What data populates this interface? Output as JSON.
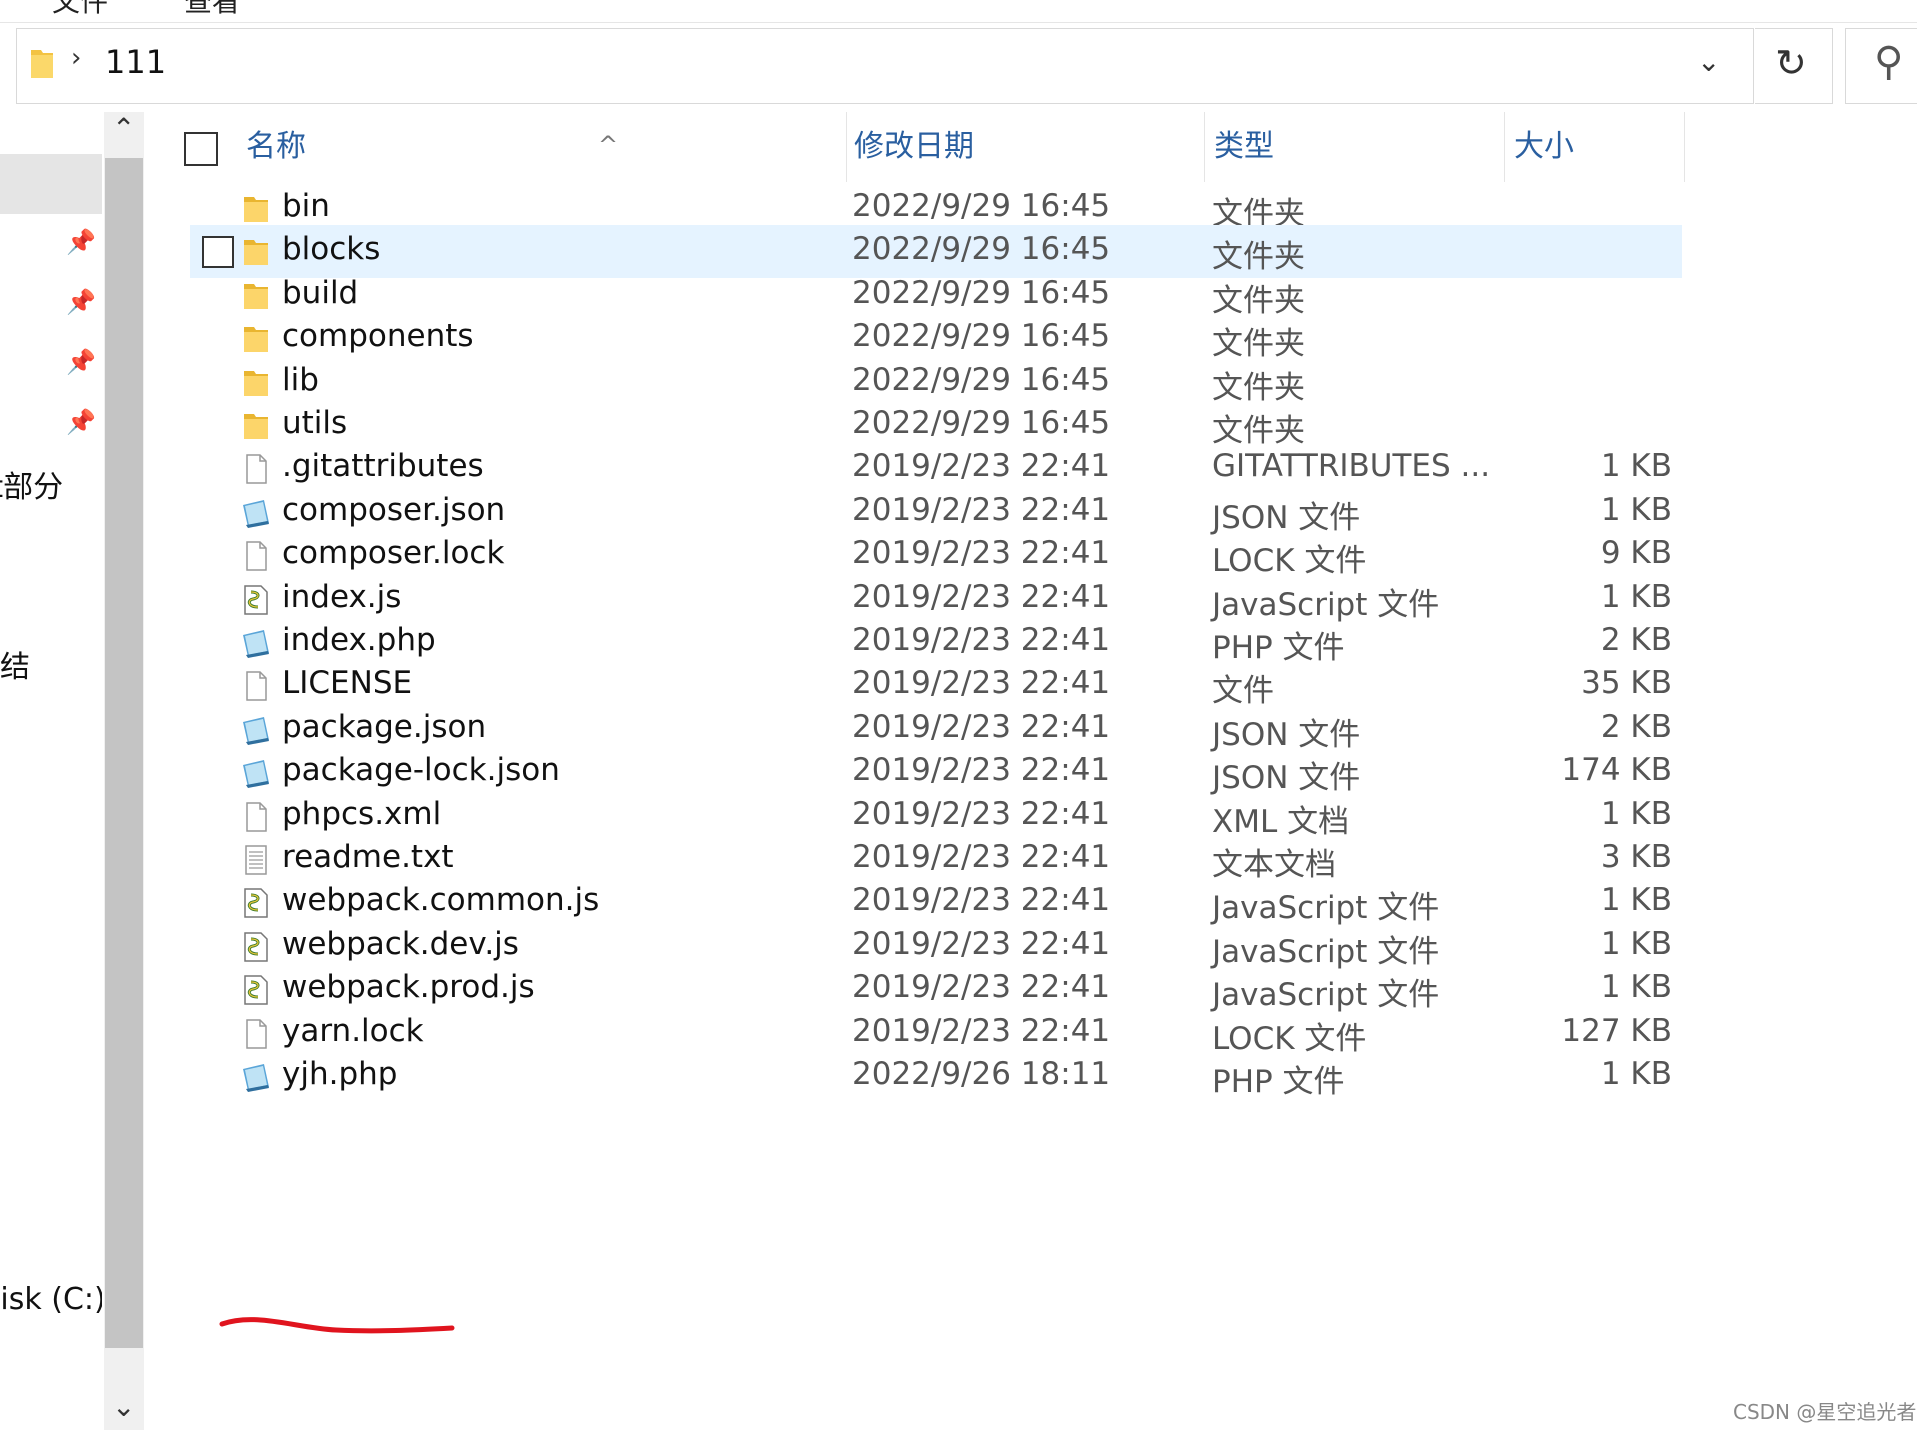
{
  "menubar": {
    "item1": "文件",
    "item2": "查看"
  },
  "address": {
    "path": "111"
  },
  "nav": {
    "label_git": "git部分",
    "label_jie": "结",
    "label_disk": "Local Disk (C:)"
  },
  "columns": {
    "name": "名称",
    "date": "修改日期",
    "type": "类型",
    "size": "大小"
  },
  "files": [
    {
      "name": "bin",
      "date": "2022/9/29 16:45",
      "type": "文件夹",
      "size": "",
      "icon": "folder-icon"
    },
    {
      "name": "blocks",
      "date": "2022/9/29 16:45",
      "type": "文件夹",
      "size": "",
      "icon": "folder-icon",
      "selected": true
    },
    {
      "name": "build",
      "date": "2022/9/29 16:45",
      "type": "文件夹",
      "size": "",
      "icon": "folder-icon"
    },
    {
      "name": "components",
      "date": "2022/9/29 16:45",
      "type": "文件夹",
      "size": "",
      "icon": "folder-icon"
    },
    {
      "name": "lib",
      "date": "2022/9/29 16:45",
      "type": "文件夹",
      "size": "",
      "icon": "folder-icon"
    },
    {
      "name": "utils",
      "date": "2022/9/29 16:45",
      "type": "文件夹",
      "size": "",
      "icon": "folder-icon"
    },
    {
      "name": ".gitattributes",
      "date": "2019/2/23 22:41",
      "type": "GITATTRIBUTES ...",
      "size": "1 KB",
      "icon": "blank-file-icon"
    },
    {
      "name": "composer.json",
      "date": "2019/2/23 22:41",
      "type": "JSON 文件",
      "size": "1 KB",
      "icon": "editor-file-icon"
    },
    {
      "name": "composer.lock",
      "date": "2019/2/23 22:41",
      "type": "LOCK 文件",
      "size": "9 KB",
      "icon": "blank-file-icon"
    },
    {
      "name": "index.js",
      "date": "2019/2/23 22:41",
      "type": "JavaScript 文件",
      "size": "1 KB",
      "icon": "script-file-icon"
    },
    {
      "name": "index.php",
      "date": "2019/2/23 22:41",
      "type": "PHP 文件",
      "size": "2 KB",
      "icon": "editor-file-icon"
    },
    {
      "name": "LICENSE",
      "date": "2019/2/23 22:41",
      "type": "文件",
      "size": "35 KB",
      "icon": "blank-file-icon"
    },
    {
      "name": "package.json",
      "date": "2019/2/23 22:41",
      "type": "JSON 文件",
      "size": "2 KB",
      "icon": "editor-file-icon"
    },
    {
      "name": "package-lock.json",
      "date": "2019/2/23 22:41",
      "type": "JSON 文件",
      "size": "174 KB",
      "icon": "editor-file-icon"
    },
    {
      "name": "phpcs.xml",
      "date": "2019/2/23 22:41",
      "type": "XML 文档",
      "size": "1 KB",
      "icon": "blank-file-icon"
    },
    {
      "name": "readme.txt",
      "date": "2019/2/23 22:41",
      "type": "文本文档",
      "size": "3 KB",
      "icon": "text-file-icon"
    },
    {
      "name": "webpack.common.js",
      "date": "2019/2/23 22:41",
      "type": "JavaScript 文件",
      "size": "1 KB",
      "icon": "script-file-icon"
    },
    {
      "name": "webpack.dev.js",
      "date": "2019/2/23 22:41",
      "type": "JavaScript 文件",
      "size": "1 KB",
      "icon": "script-file-icon"
    },
    {
      "name": "webpack.prod.js",
      "date": "2019/2/23 22:41",
      "type": "JavaScript 文件",
      "size": "1 KB",
      "icon": "script-file-icon"
    },
    {
      "name": "yarn.lock",
      "date": "2019/2/23 22:41",
      "type": "LOCK 文件",
      "size": "127 KB",
      "icon": "blank-file-icon"
    },
    {
      "name": "yjh.php",
      "date": "2022/9/26 18:11",
      "type": "PHP 文件",
      "size": "1 KB",
      "icon": "editor-file-icon"
    }
  ],
  "watermark": "CSDN @星空追光者",
  "colors": {
    "selected_row": "#e5f3ff",
    "header_text": "#2a5fa0",
    "annotation": "#e0141e"
  }
}
